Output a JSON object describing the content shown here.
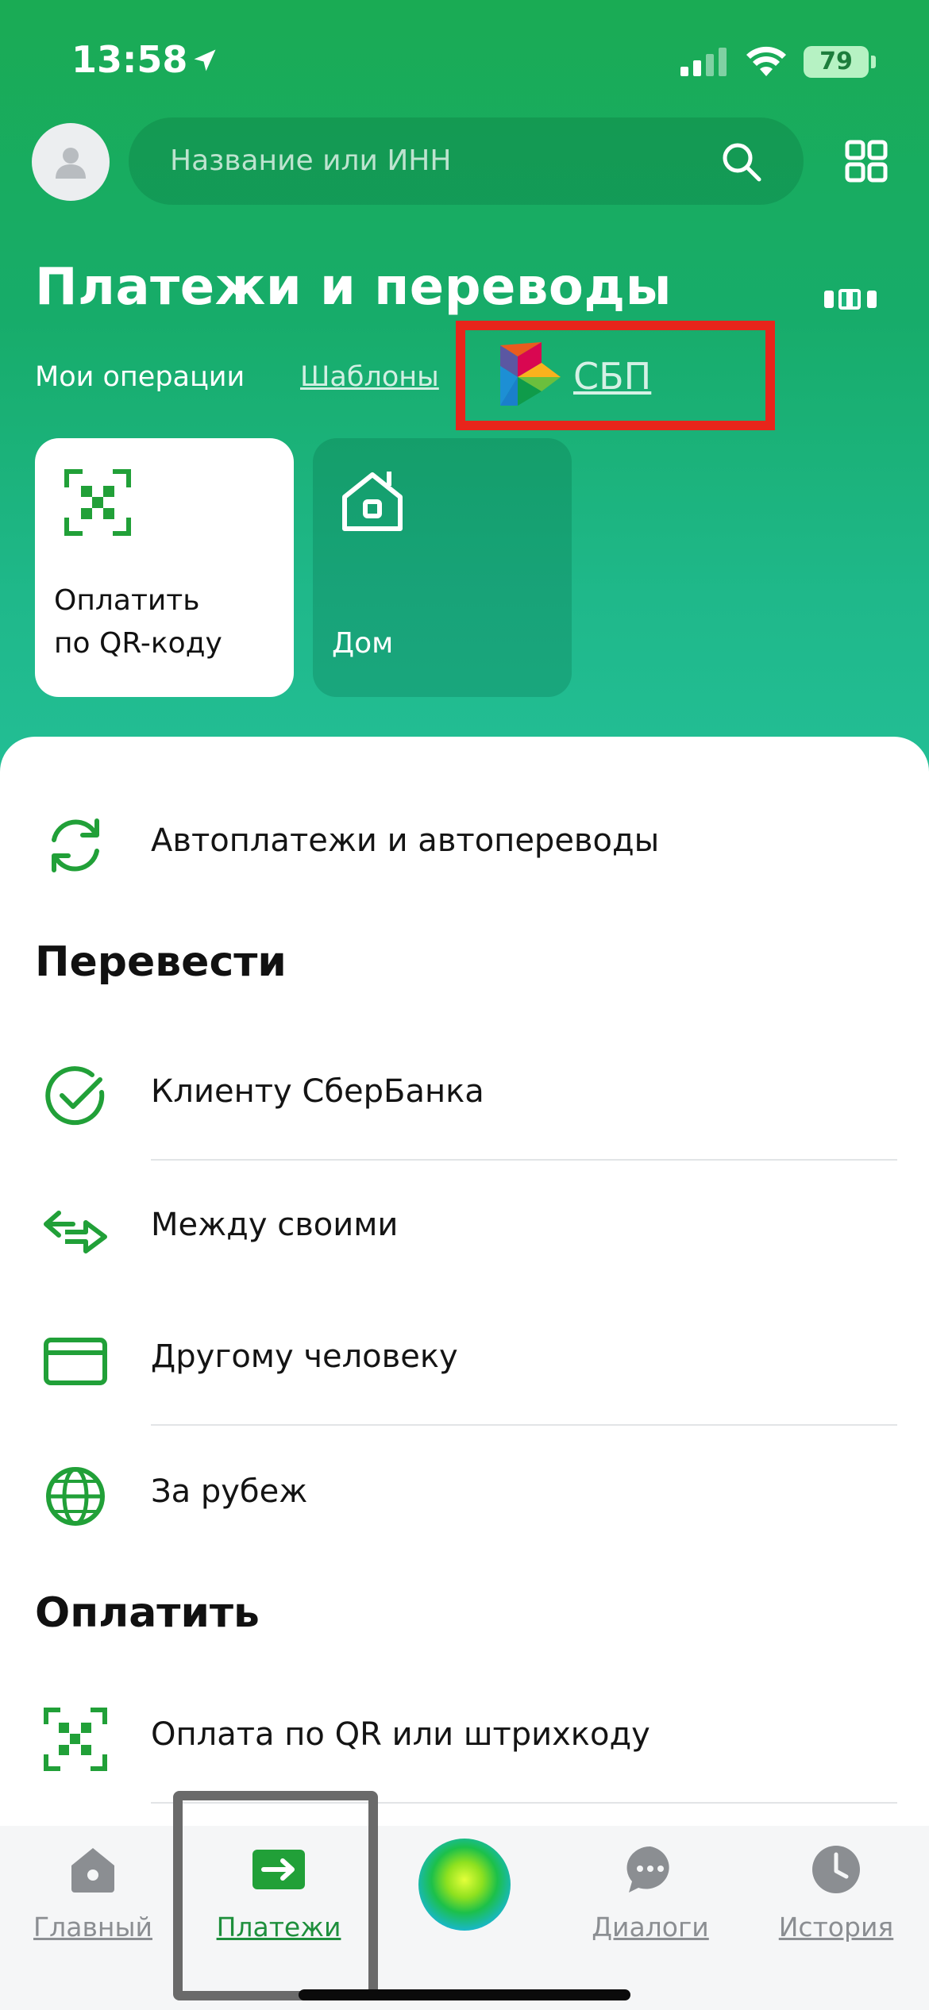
{
  "status_bar": {
    "time": "13:58",
    "battery": "79"
  },
  "header": {
    "search_placeholder": "Название или ИНН"
  },
  "title": "Платежи и переводы",
  "subnav": {
    "operations": "Мои операции",
    "templates": "Шаблоны",
    "sbp": "СБП"
  },
  "tiles": [
    {
      "label_line1": "Оплатить",
      "label_line2": "по QR-коду",
      "icon": "qr-icon"
    },
    {
      "label_line1": "Дом",
      "label_line2": "",
      "icon": "house-icon"
    }
  ],
  "autopay": {
    "label": "Автоплатежи и автопереводы",
    "icon": "refresh-icon"
  },
  "transfer": {
    "title": "Перевести",
    "items": [
      {
        "label": "Клиенту СберБанка",
        "icon": "checkmark-circle-icon"
      },
      {
        "label": "Между своими",
        "icon": "arrows-between-icon"
      },
      {
        "label": "Другому человеку",
        "icon": "card-icon"
      },
      {
        "label": "За рубеж",
        "icon": "globe-icon"
      }
    ]
  },
  "pay": {
    "title": "Оплатить",
    "items": [
      {
        "label": "Оплата по QR или штрихкоду",
        "icon": "qr-icon"
      }
    ]
  },
  "bottom_nav": [
    {
      "label": "Главный",
      "icon": "home-icon",
      "active": false
    },
    {
      "label": "Платежи",
      "icon": "payments-icon",
      "active": true
    },
    {
      "label": "",
      "icon": "assistant-orb-icon",
      "active": false
    },
    {
      "label": "Диалоги",
      "icon": "chat-icon",
      "active": false
    },
    {
      "label": "История",
      "icon": "clock-icon",
      "active": false
    }
  ],
  "colors": {
    "brand_green": "#21a038",
    "highlight_red": "#e8251b",
    "highlight_gray": "#6a6a6a"
  }
}
